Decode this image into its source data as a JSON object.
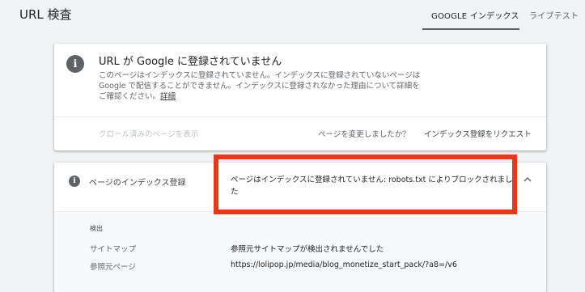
{
  "header": {
    "title": "URL 検査",
    "tabs": [
      {
        "label": "GOOGLE インデックス",
        "active": true
      },
      {
        "label": "ライブテスト",
        "active": false
      }
    ]
  },
  "status_card": {
    "icon": "info-icon",
    "headline": "URL が Google に登録されていません",
    "description": "このページはインデックスに登録されていません。インデックスに登録されていないページは Google で配信することができません。インデックスに登録されなかった理由について詳細をご確認ください。",
    "detail_link": "詳細",
    "actions": {
      "view_crawled": "クロール済みのページを表示",
      "page_changed": "ページを変更しましたか？",
      "request_indexing": "インデックス登録をリクエスト"
    }
  },
  "coverage_section": {
    "icon": "info-icon",
    "title": "ページのインデックス登録",
    "status": "ページはインデックスに登録されていません: robots.txt によりブロックされました",
    "detection_label": "検出",
    "rows": [
      {
        "label": "サイトマップ",
        "value": "参照元サイトマップが検出されませんでした"
      },
      {
        "label": "参照元ページ",
        "value": "https://lolipop.jp/media/blog_monetize_start_pack/?a8=/v6"
      }
    ]
  },
  "colors": {
    "background": "#f1f3f4",
    "highlight_border": "#e8381b",
    "icon_gray": "#5f6368"
  }
}
